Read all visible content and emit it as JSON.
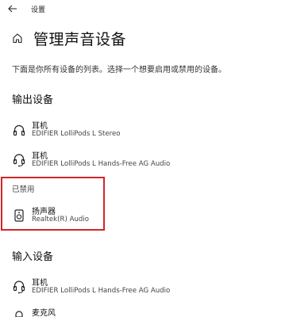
{
  "window": {
    "title": "设置"
  },
  "header": {
    "title": "管理声音设备"
  },
  "description": "下面是你所有设备的列表。选择一个想要启用或禁用的设备。",
  "output": {
    "heading": "输出设备",
    "devices": [
      {
        "name": "耳机",
        "sub": "EDIFIER LolliPods L Stereo",
        "icon": "headphones-icon"
      },
      {
        "name": "耳机",
        "sub": "EDIFIER LolliPods L Hands-Free AG Audio",
        "icon": "headset-icon"
      }
    ]
  },
  "disabled": {
    "label": "已禁用",
    "devices": [
      {
        "name": "扬声器",
        "sub": "Realtek(R) Audio",
        "icon": "speaker-icon"
      }
    ]
  },
  "input": {
    "heading": "输入设备",
    "devices": [
      {
        "name": "耳机",
        "sub": "EDIFIER LolliPods L Hands-Free AG Audio",
        "icon": "headset-icon"
      },
      {
        "name": "麦克风",
        "sub": "",
        "icon": "microphone-icon"
      }
    ]
  },
  "colors": {
    "highlight_border": "#d0262b"
  }
}
